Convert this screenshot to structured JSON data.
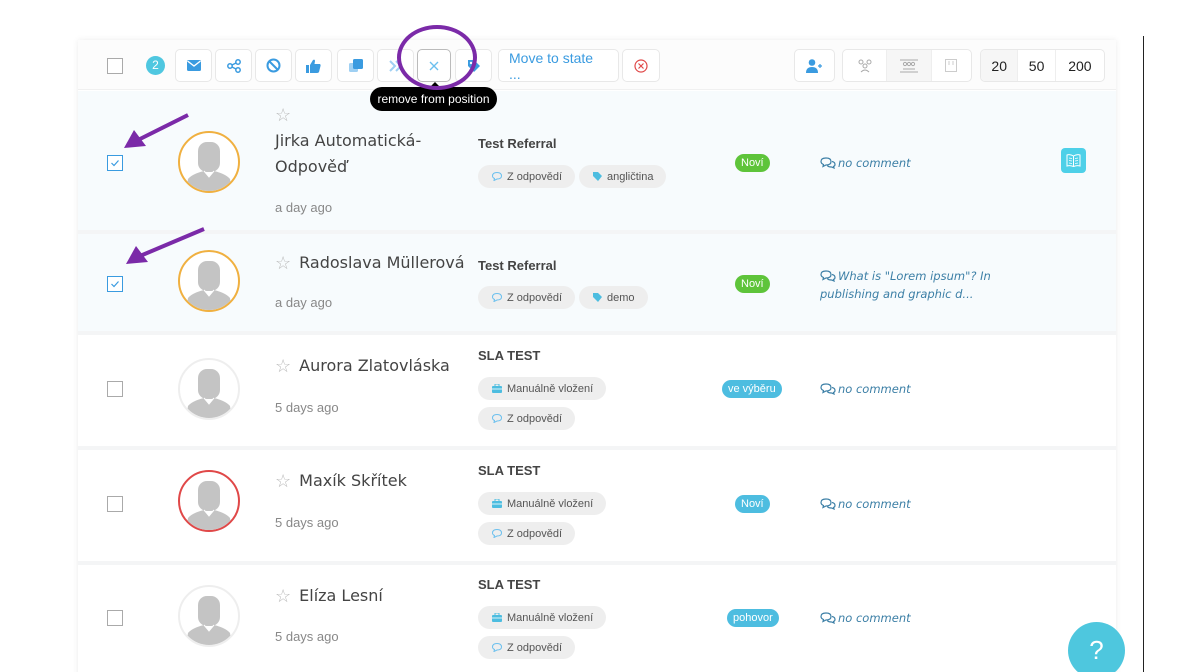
{
  "toolbar": {
    "selected_count": "2",
    "icons": [
      "envelope-icon",
      "share-icon",
      "ban-icon",
      "thumbs-up-icon",
      "copy-icon",
      "forward-icon",
      "close-icon",
      "tag-icon"
    ],
    "move_to_state_label": "Move to state ...",
    "tooltip": "remove from position",
    "view_icons": [
      "add-user-icon",
      "group-icon",
      "list-group-icon",
      "kanban-icon"
    ],
    "page_sizes": [
      "20",
      "50",
      "200"
    ],
    "selected_page_size": "20"
  },
  "rows": [
    {
      "checked": true,
      "name": "Jirka Automatická-Odpověď",
      "name_line1": "Jirka Automatická-",
      "name_line2": "Odpověď",
      "time": "a day ago",
      "title": "Test Referral",
      "chips": [
        {
          "icon": "comment-icon",
          "label": "Z odpovědí"
        },
        {
          "icon": "tag-icon",
          "label": "angličtina"
        }
      ],
      "status": "Noví",
      "status_color": "#5ec43a",
      "comment": "no comment",
      "avatar_ring": "#f0b040"
    },
    {
      "checked": true,
      "name": "Radoslava Müllerová",
      "time": "a day ago",
      "title": "Test Referral",
      "chips": [
        {
          "icon": "comment-icon",
          "label": "Z odpovědí"
        },
        {
          "icon": "tag-icon",
          "label": "demo"
        }
      ],
      "status": "Noví",
      "status_color": "#5ec43a",
      "comment": "What is \"Lorem ipsum\"? In publishing and graphic d...",
      "avatar_ring": "#f0b040"
    },
    {
      "checked": false,
      "name": "Aurora Zlatovláska",
      "time": "5 days ago",
      "title": "SLA TEST",
      "chips": [
        {
          "icon": "briefcase-icon",
          "label": "Manuálně vložení"
        },
        {
          "icon": "comment-icon",
          "label": "Z odpovědí"
        }
      ],
      "status": "ve výběru",
      "status_color": "#4dbde0",
      "comment": "no comment",
      "avatar_ring": "#eeeeee"
    },
    {
      "checked": false,
      "name": "Maxík Skřítek",
      "time": "5 days ago",
      "title": "SLA TEST",
      "chips": [
        {
          "icon": "briefcase-icon",
          "label": "Manuálně vložení"
        },
        {
          "icon": "comment-icon",
          "label": "Z odpovědí"
        }
      ],
      "status": "Noví",
      "status_color": "#4dbde0",
      "comment": "no comment",
      "avatar_ring": "#e04848"
    },
    {
      "checked": false,
      "name": "Elíza Lesní",
      "time": "5 days ago",
      "title": "SLA TEST",
      "chips": [
        {
          "icon": "briefcase-icon",
          "label": "Manuálně vložení"
        },
        {
          "icon": "comment-icon",
          "label": "Z odpovědí"
        }
      ],
      "status": "pohovor",
      "status_color": "#4dbde0",
      "comment": "no comment",
      "avatar_ring": "#eeeeee"
    }
  ],
  "help_label": "?"
}
